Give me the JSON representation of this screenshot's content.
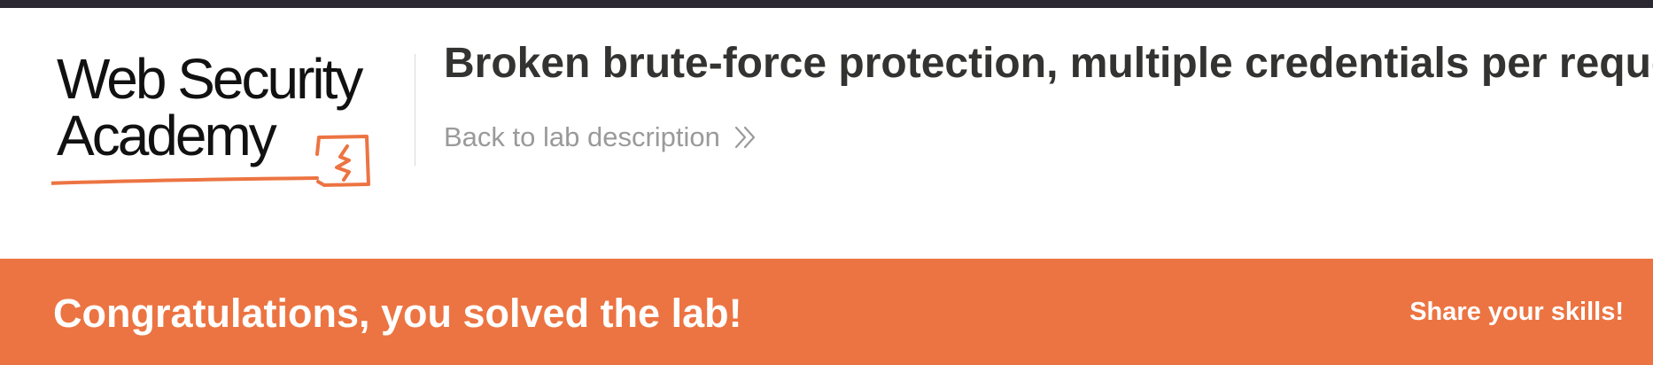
{
  "header": {
    "logo": {
      "line1": "Web Security",
      "line2": "Academy",
      "accent_color": "#ec7442"
    },
    "lab_title": "Broken brute-force protection, multiple credentials per request",
    "back_link_label": "Back to lab description",
    "back_link_icon": "double-chevron-right-icon"
  },
  "banner": {
    "message": "Congratulations, you solved the lab!",
    "share_label": "Share your skills!",
    "color": "#ec7442"
  },
  "theme": {
    "top_strip_color": "#2b2832",
    "title_color": "#333332",
    "link_color": "#9a9a9a"
  }
}
